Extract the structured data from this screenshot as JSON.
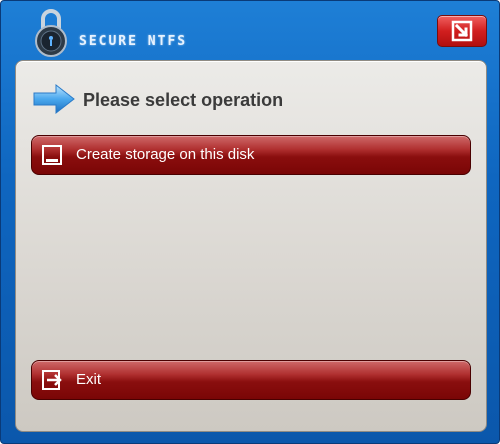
{
  "window": {
    "title": "SECURE NTFS"
  },
  "icons": {
    "lock": "padlock-icon",
    "close": "exit-arrow-icon",
    "heading_arrow": "arrow-right-icon",
    "create": "disk-icon",
    "exit": "exit-door-icon"
  },
  "colors": {
    "frame_blue": "#0f66c0",
    "button_red": "#8a0e0e",
    "close_red": "#d11f1f",
    "panel_gray": "#dedbd6"
  },
  "main": {
    "heading": "Please select operation",
    "buttons": [
      {
        "label": "Create storage on this disk"
      },
      {
        "label": "Exit"
      }
    ]
  }
}
